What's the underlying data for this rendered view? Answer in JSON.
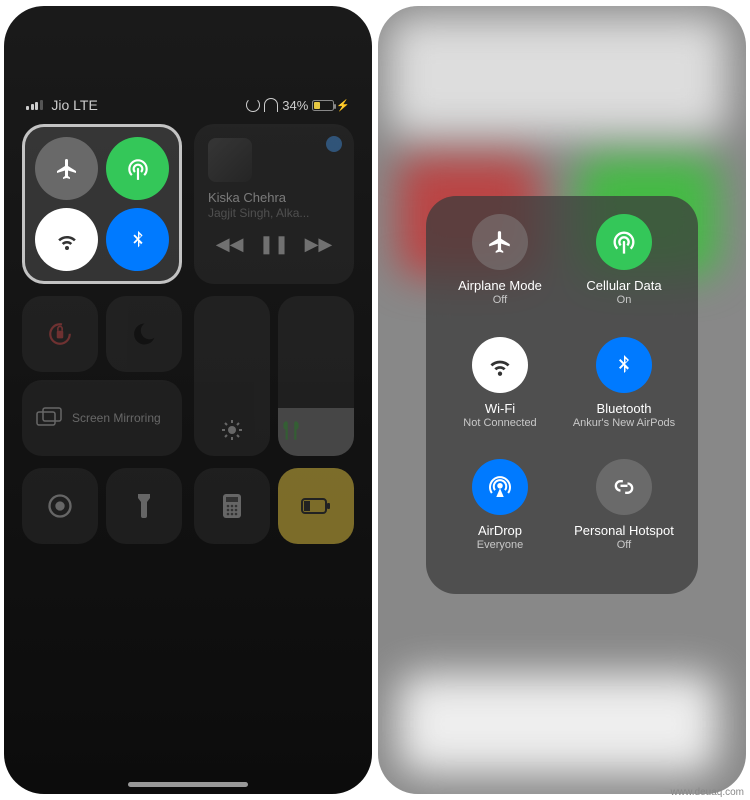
{
  "status": {
    "carrier": "Jio LTE",
    "battery_pct": "34%"
  },
  "left": {
    "music": {
      "title": "Kiska Chehra",
      "artist": "Jagjit Singh, Alka..."
    },
    "mirror_label": "Screen Mirroring"
  },
  "right": {
    "airplane": {
      "label": "Airplane Mode",
      "status": "Off"
    },
    "cellular": {
      "label": "Cellular Data",
      "status": "On"
    },
    "wifi": {
      "label": "Wi-Fi",
      "status": "Not Connected"
    },
    "bluetooth": {
      "label": "Bluetooth",
      "status": "Ankur's New AirPods"
    },
    "airdrop": {
      "label": "AirDrop",
      "status": "Everyone"
    },
    "hotspot": {
      "label": "Personal Hotspot",
      "status": "Off"
    }
  },
  "watermark": "www.deuaq.com"
}
